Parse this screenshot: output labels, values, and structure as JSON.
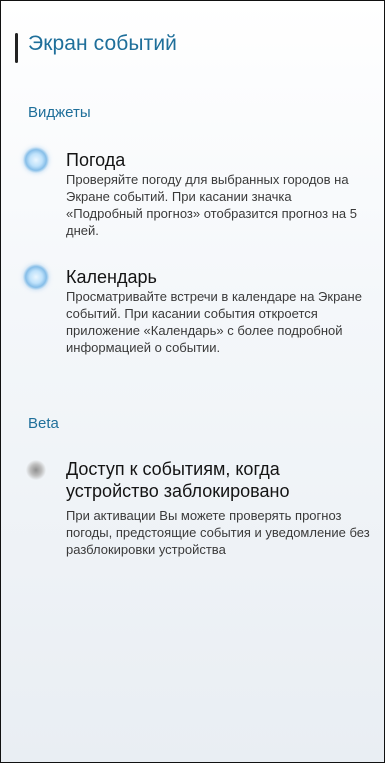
{
  "page": {
    "title": "Экран событий"
  },
  "sections": [
    {
      "title": "Виджеты",
      "items": [
        {
          "title": "Погода",
          "description": "Проверяйте погоду для выбранных городов на Экране событий. При касании значка «Подробный прогноз» отобразится прогноз на 5 дней.",
          "icon": "radio-selected-icon",
          "enabled": true
        },
        {
          "title": "Календарь",
          "description": "Просматривайте встречи в календаре на Экране событий. При касании события откроется приложение «Календарь» с более подробной информацией о событии.",
          "icon": "radio-selected-icon",
          "enabled": true
        }
      ]
    },
    {
      "title": "Beta",
      "items": [
        {
          "title": "Доступ к событиям, когда устройство заблокировано",
          "description": "При активации Вы можете проверять прогноз погоды, предстоящие события и уведомление без разблокировки устройства",
          "icon": "radio-unselected-icon",
          "enabled": false
        }
      ]
    }
  ],
  "colors": {
    "accent": "#1f6f9a",
    "text_primary": "#141414",
    "text_secondary": "#3a3a3a"
  }
}
